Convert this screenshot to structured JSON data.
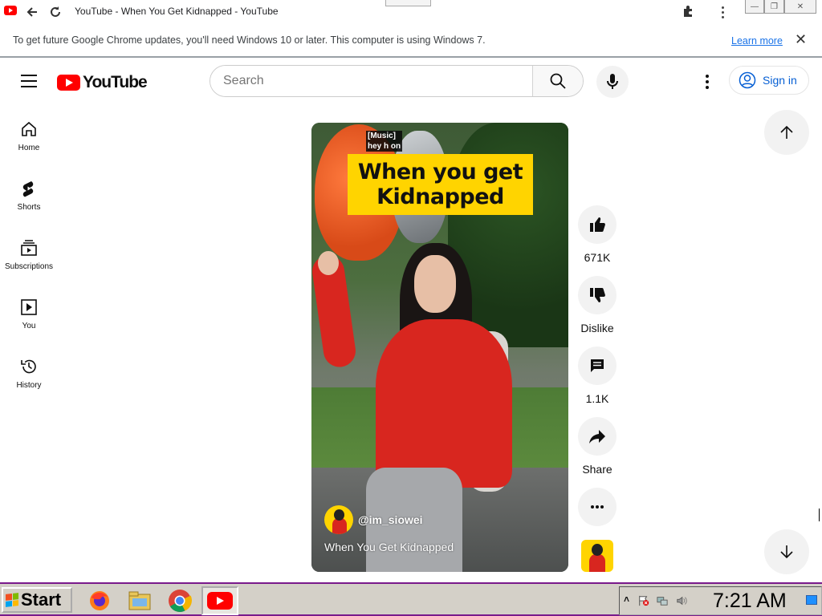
{
  "browser": {
    "tab_title": "YouTube - When You Get Kidnapped - YouTube",
    "infobar_message": "To get future Google Chrome updates, you'll need Windows 10 or later. This computer is using Windows 7.",
    "infobar_link": "Learn more"
  },
  "masthead": {
    "logo_text": "YouTube",
    "search_placeholder": "Search",
    "sign_in": "Sign in"
  },
  "guide": {
    "items": [
      {
        "label": "Home",
        "icon": "home-icon"
      },
      {
        "label": "Shorts",
        "icon": "shorts-icon"
      },
      {
        "label": "Subscriptions",
        "icon": "subscriptions-icon"
      },
      {
        "label": "You",
        "icon": "you-icon"
      },
      {
        "label": "History",
        "icon": "history-icon"
      }
    ]
  },
  "short": {
    "caption_line1": "[Music]",
    "caption_line2": "hey h on",
    "overlay_line1": "When you get",
    "overlay_line2": "Kidnapped",
    "channel": "@im_siowei",
    "title": "When You Get Kidnapped"
  },
  "actions": {
    "like_count": "671K",
    "dislike_label": "Dislike",
    "comment_count": "1.1K",
    "share_label": "Share"
  },
  "taskbar": {
    "start_label": "Start",
    "clock": "7:21 AM"
  },
  "colors": {
    "youtube_red": "#ff0000",
    "link_blue": "#065fd4",
    "overlay_yellow": "#ffd400",
    "taskbar_border": "#7a1a8c"
  }
}
